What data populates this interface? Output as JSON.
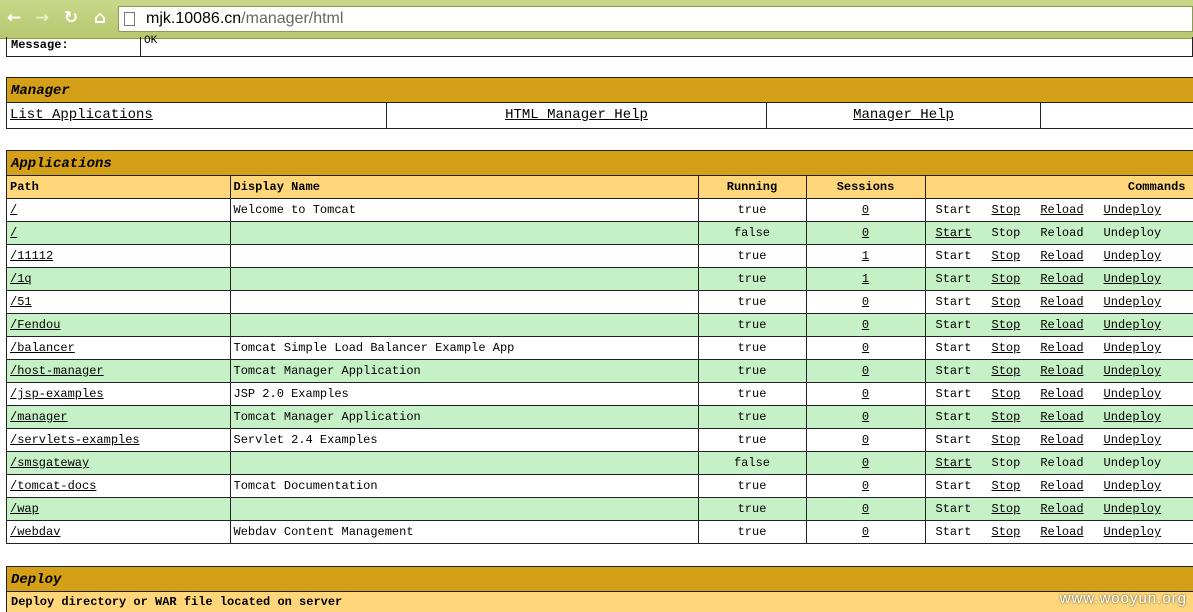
{
  "browser": {
    "url_host": "mjk.10086.cn",
    "url_path": "/manager/html"
  },
  "message": {
    "label": "Message:",
    "value": "OK"
  },
  "manager": {
    "title": "Manager",
    "links": [
      "List Applications",
      "HTML Manager Help",
      "Manager Help"
    ]
  },
  "applications": {
    "title": "Applications",
    "headers": [
      "Path",
      "Display Name",
      "Running",
      "Sessions",
      "Commands"
    ],
    "rows": [
      {
        "path": "/",
        "name": "Welcome to Tomcat",
        "running": "true",
        "sessions": "0"
      },
      {
        "path": "/",
        "name": "",
        "running": "false",
        "sessions": "0"
      },
      {
        "path": "/11112",
        "name": "",
        "running": "true",
        "sessions": "1"
      },
      {
        "path": "/1q",
        "name": "",
        "running": "true",
        "sessions": "1"
      },
      {
        "path": "/51",
        "name": "",
        "running": "true",
        "sessions": "0"
      },
      {
        "path": "/Fendou",
        "name": "",
        "running": "true",
        "sessions": "0"
      },
      {
        "path": "/balancer",
        "name": "Tomcat Simple Load Balancer Example App",
        "running": "true",
        "sessions": "0"
      },
      {
        "path": "/host-manager",
        "name": "Tomcat Manager Application",
        "running": "true",
        "sessions": "0"
      },
      {
        "path": "/jsp-examples",
        "name": "JSP 2.0 Examples",
        "running": "true",
        "sessions": "0"
      },
      {
        "path": "/manager",
        "name": "Tomcat Manager Application",
        "running": "true",
        "sessions": "0"
      },
      {
        "path": "/servlets-examples",
        "name": "Servlet 2.4 Examples",
        "running": "true",
        "sessions": "0"
      },
      {
        "path": "/smsgateway",
        "name": "",
        "running": "false",
        "sessions": "0"
      },
      {
        "path": "/tomcat-docs",
        "name": "Tomcat Documentation",
        "running": "true",
        "sessions": "0"
      },
      {
        "path": "/wap",
        "name": "",
        "running": "true",
        "sessions": "0"
      },
      {
        "path": "/webdav",
        "name": "Webdav Content Management",
        "running": "true",
        "sessions": "0"
      }
    ],
    "commands": [
      "Start",
      "Stop",
      "Reload",
      "Undeploy"
    ]
  },
  "deploy": {
    "title": "Deploy",
    "subtitle": "Deploy directory or WAR file located on server"
  },
  "watermark": "www.wooyun.org"
}
